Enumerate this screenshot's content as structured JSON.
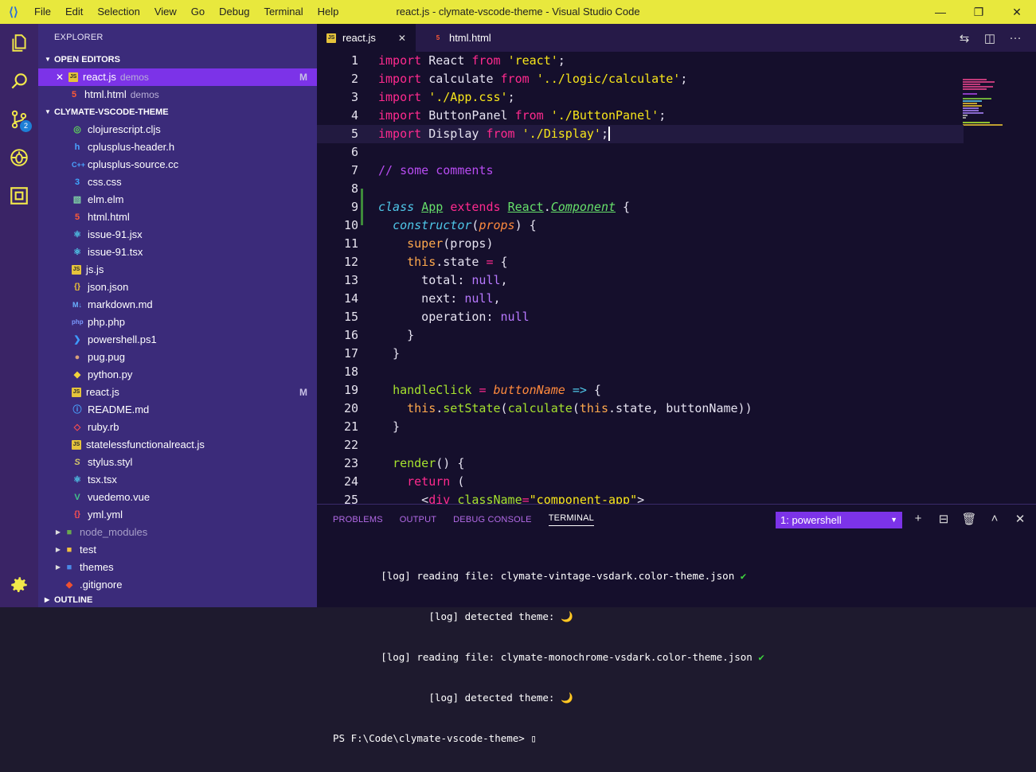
{
  "window": {
    "title": "react.js - clymate-vscode-theme - Visual Studio Code",
    "menu": [
      "File",
      "Edit",
      "Selection",
      "View",
      "Go",
      "Debug",
      "Terminal",
      "Help"
    ],
    "controls": [
      "—",
      "❐",
      "✕"
    ]
  },
  "activity": {
    "scm_badge": "2"
  },
  "sidebar": {
    "title": "EXPLORER",
    "open_editors_label": "OPEN EDITORS",
    "open_editors": [
      {
        "name": "react.js",
        "dir": "demos",
        "status": "M"
      },
      {
        "name": "html.html",
        "dir": "demos",
        "status": ""
      }
    ],
    "project_label": "CLYMATE-VSCODE-THEME",
    "files": [
      "clojurescript.cljs",
      "cplusplus-header.h",
      "cplusplus-source.cc",
      "css.css",
      "elm.elm",
      "html.html",
      "issue-91.jsx",
      "issue-91.tsx",
      "js.js",
      "json.json",
      "markdown.md",
      "php.php",
      "powershell.ps1",
      "pug.pug",
      "python.py",
      "react.js",
      "README.md",
      "ruby.rb",
      "statelessfunctionalreact.js",
      "stylus.styl",
      "tsx.tsx",
      "vuedemo.vue",
      "yml.yml"
    ],
    "react_status": "M",
    "folders": [
      "node_modules",
      "test",
      "themes"
    ],
    "gitignore": ".gitignore",
    "outline_label": "OUTLINE"
  },
  "tabs": [
    {
      "label": "react.js",
      "close": "✕"
    },
    {
      "label": "html.html"
    }
  ],
  "code": {
    "line_numbers": [
      "1",
      "2",
      "3",
      "4",
      "5",
      "6",
      "7",
      "8",
      "9",
      "10",
      "11",
      "12",
      "13",
      "14",
      "15",
      "16",
      "17",
      "18",
      "19",
      "20",
      "21",
      "22",
      "23",
      "24",
      "25"
    ],
    "l1": [
      "import",
      " React ",
      "from",
      " ",
      "'react'",
      ";"
    ],
    "l2": [
      "import",
      " calculate ",
      "from",
      " ",
      "'../logic/calculate'",
      ";"
    ],
    "l3": [
      "import",
      " ",
      "'./App.css'",
      ";"
    ],
    "l4": [
      "import",
      " ButtonPanel ",
      "from",
      " ",
      "'./ButtonPanel'",
      ";"
    ],
    "l5": [
      "import",
      " Display ",
      "from",
      " ",
      "'./Display'",
      ";"
    ],
    "l7": "// some comments",
    "l9": [
      "class",
      " ",
      "App",
      " ",
      "extends",
      " ",
      "React",
      ".",
      "Component",
      " {"
    ],
    "l10": [
      "  ",
      "constructor",
      "(",
      "props",
      ") {"
    ],
    "l11": [
      "    ",
      "super",
      "(props)"
    ],
    "l12": [
      "    ",
      "this",
      ".state ",
      "=",
      " {"
    ],
    "l13": [
      "      total: ",
      "null",
      ","
    ],
    "l14": [
      "      next: ",
      "null",
      ","
    ],
    "l15": [
      "      operation: ",
      "null"
    ],
    "l16": "    }",
    "l17": "  }",
    "l19": [
      "  ",
      "handleClick",
      " ",
      "=",
      " ",
      "buttonName",
      " ",
      "=>",
      " {"
    ],
    "l20": [
      "    ",
      "this",
      ".",
      "setState",
      "(",
      "calculate",
      "(",
      "this",
      ".state, buttonName))"
    ],
    "l21": "  }",
    "l23": [
      "  ",
      "render",
      "() {"
    ],
    "l24": [
      "    ",
      "return",
      " ("
    ],
    "l25": [
      "      <",
      "div",
      " ",
      "className",
      "=",
      "\"component-app\"",
      ">"
    ]
  },
  "panel": {
    "tabs": [
      "PROBLEMS",
      "OUTPUT",
      "DEBUG CONSOLE",
      "TERMINAL"
    ],
    "terminal_select": "1: powershell",
    "actions": [
      "+",
      "⊟",
      "🗑",
      "˄",
      "✕"
    ],
    "lines": [
      "        [log] reading file: clymate-vintage-vsdark.color-theme.json ",
      "                [log] detected theme: 🌙",
      "        [log] reading file: clymate-monochrome-vsdark.color-theme.json ",
      "                [log] detected theme: 🌙",
      "PS F:\\Code\\clymate-vscode-theme> "
    ],
    "check": "✔",
    "prompt_cursor": "▯"
  }
}
